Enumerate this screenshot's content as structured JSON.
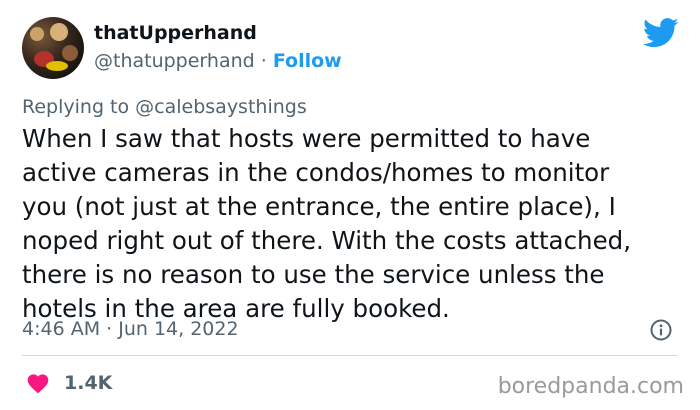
{
  "author": {
    "display_name": "thatUpperhand",
    "handle": "@thatupperhand",
    "separator": "·",
    "follow_label": "Follow"
  },
  "reply": {
    "prefix": "Replying to ",
    "mention": "@calebsaysthings"
  },
  "tweet": {
    "lines": [
      "When I saw that hosts were permitted to have",
      "active cameras in the condos/homes to monitor",
      "you (not just at the entrance, the entire place), I",
      "noped right out of there. With the costs attached,",
      "there is no reason to use the service unless the",
      "hotels in the area are fully booked."
    ],
    "timestamp": "4:46 AM · Jun 14, 2022"
  },
  "engagement": {
    "likes": "1.4K"
  },
  "watermark": "boredpanda.com",
  "colors": {
    "twitter_blue": "#1d9bf0",
    "heart_pink": "#f91880",
    "muted": "#536471",
    "text": "#0f1419"
  },
  "icons": [
    "avatar-image",
    "twitter-bird-icon",
    "info-icon",
    "heart-icon"
  ]
}
